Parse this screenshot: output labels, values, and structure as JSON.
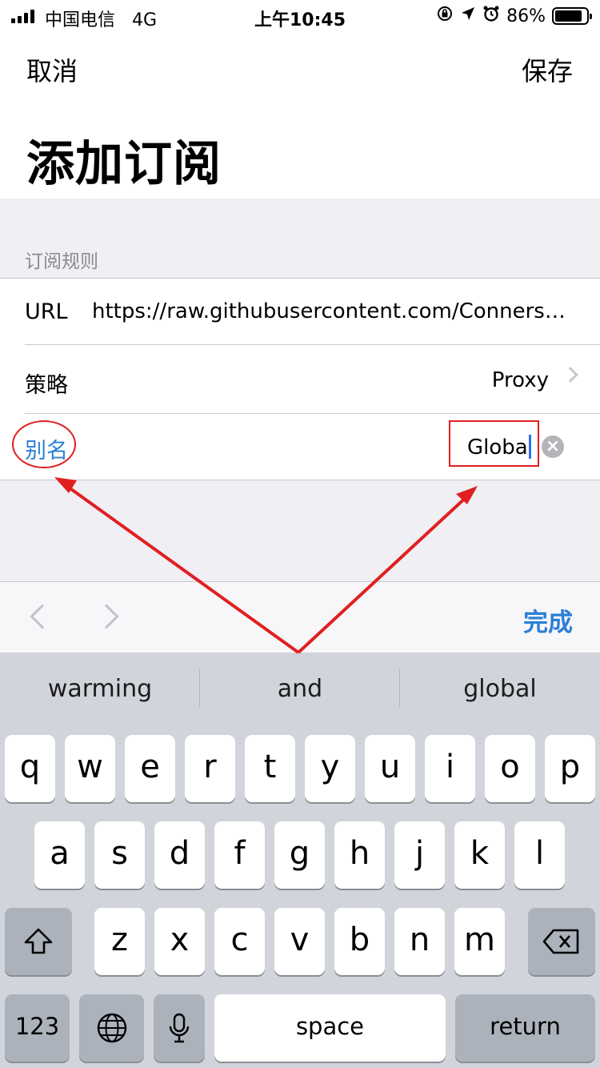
{
  "status_bar": {
    "carrier": "中国电信",
    "network": "4G",
    "time": "上午10:45",
    "battery": "86%",
    "battery_level": 0.86
  },
  "nav": {
    "cancel": "取消",
    "save": "保存",
    "title": "添加订阅"
  },
  "section": {
    "header": "订阅规则"
  },
  "rows": {
    "url_label": "URL",
    "url_value": "https://raw.githubusercontent.com/ConnersH...",
    "policy_label": "策略",
    "policy_value": "Proxy",
    "alias_label": "别名",
    "alias_value": "Globa"
  },
  "accessory": {
    "done": "完成"
  },
  "keyboard": {
    "suggestions": [
      "warming",
      "and",
      "global"
    ],
    "row1": [
      "q",
      "w",
      "e",
      "r",
      "t",
      "y",
      "u",
      "i",
      "o",
      "p"
    ],
    "row2": [
      "a",
      "s",
      "d",
      "f",
      "g",
      "h",
      "j",
      "k",
      "l"
    ],
    "row3": [
      "z",
      "x",
      "c",
      "v",
      "b",
      "n",
      "m"
    ],
    "numbers_key": "123",
    "space_key": "space",
    "return_key": "return"
  },
  "colors": {
    "accent": "#2a7fd6",
    "annotation": "#e02020",
    "grouped_background": "#efeff4",
    "keyboard_background": "#d1d4da"
  }
}
